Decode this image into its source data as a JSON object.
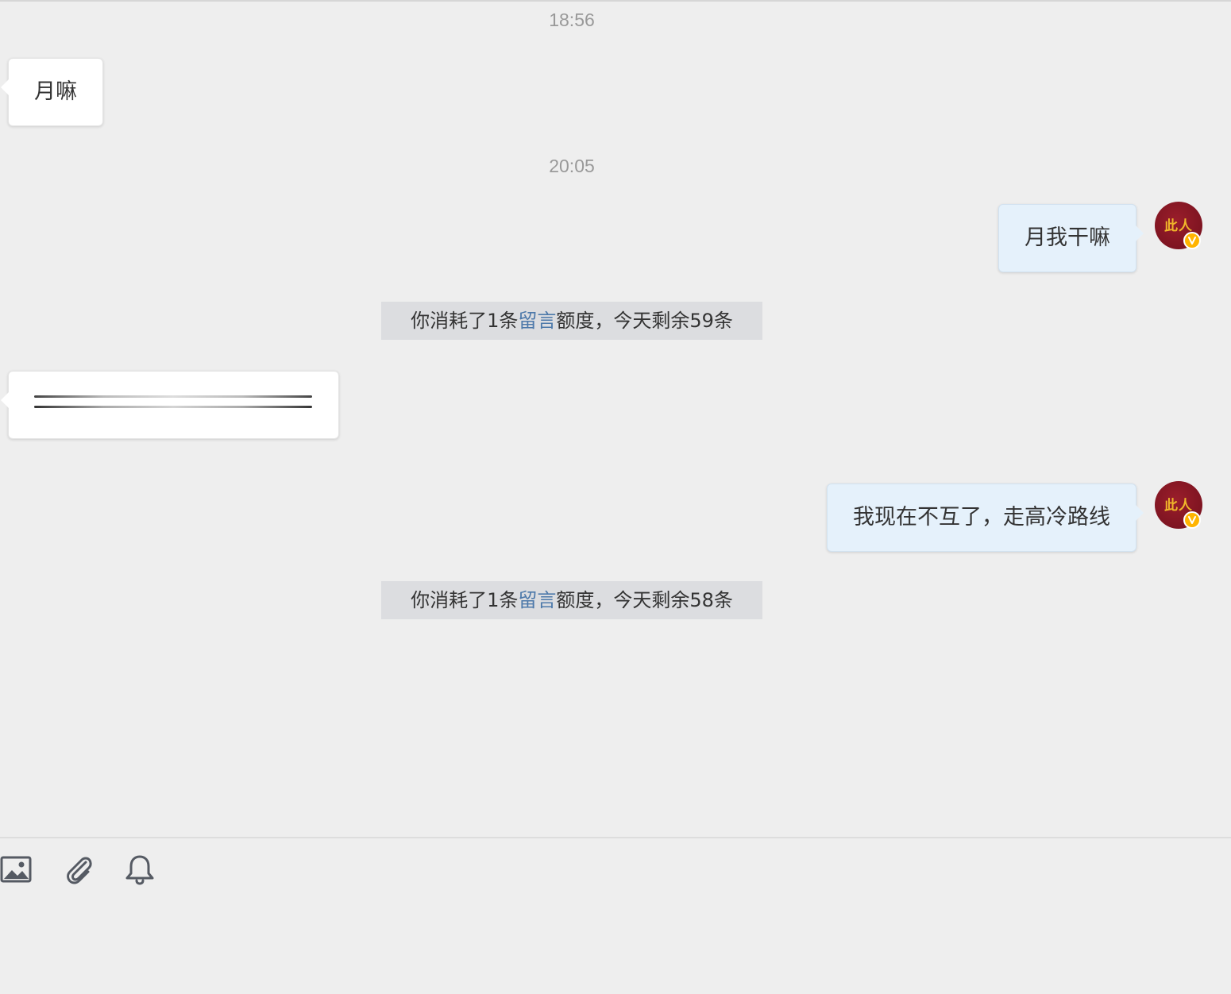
{
  "messages": {
    "timestamp_1": "18:56",
    "incoming_1": "月嘛",
    "timestamp_2": "20:05",
    "outgoing_1": "月我干嘛",
    "notice_1": {
      "prefix": "你消耗了1条",
      "link": "留言",
      "suffix": "额度，今天剩余59条"
    },
    "outgoing_2": "我现在不互了，走高冷路线",
    "notice_2": {
      "prefix": "你消耗了1条",
      "link": "留言",
      "suffix": "额度，今天剩余58条"
    }
  },
  "avatar": {
    "text": "此人",
    "badge": "V"
  },
  "toolbar": {
    "icons": [
      "image-icon",
      "attachment-icon",
      "bell-icon"
    ]
  },
  "colors": {
    "background": "#eeeeee",
    "outgoing_bubble": "#e5f1fb",
    "incoming_bubble": "#ffffff",
    "notice_bg": "#dcdde0",
    "link": "#4d79aa",
    "timestamp": "#999999",
    "avatar_bg": "#7e1421",
    "badge": "#ffb400"
  }
}
